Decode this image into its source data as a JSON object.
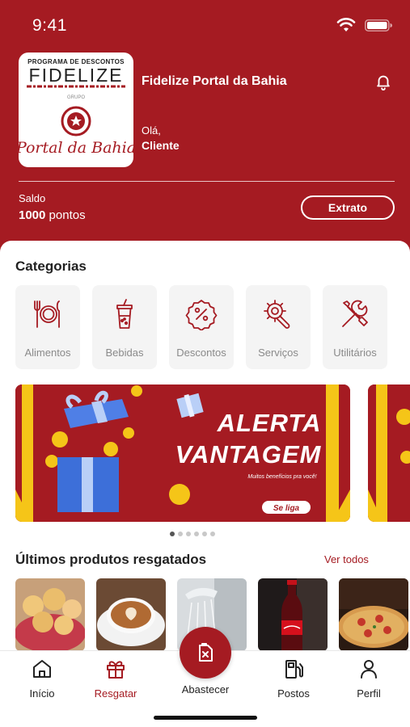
{
  "status": {
    "time": "9:41"
  },
  "header": {
    "logo": {
      "program_text": "PROGRAMA DE DESCONTOS",
      "brand_text": "FIDELIZE",
      "group_text": "GRUPO",
      "script_text": "Portal da Bahia"
    },
    "title": "Fidelize Portal da Bahia",
    "greeting": "Olá,",
    "user_name": "Cliente",
    "balance_label": "Saldo",
    "balance_value": "1000",
    "balance_unit": "pontos",
    "statement_button": "Extrato"
  },
  "categories": {
    "title": "Categorias",
    "items": [
      {
        "label": "Alimentos",
        "icon": "plate-cutlery-icon"
      },
      {
        "label": "Bebidas",
        "icon": "drink-cup-icon"
      },
      {
        "label": "Descontos",
        "icon": "percent-badge-icon"
      },
      {
        "label": "Serviços",
        "icon": "gear-wrench-icon"
      },
      {
        "label": "Utilitários",
        "icon": "tools-icon"
      }
    ]
  },
  "banner": {
    "line1": "ALERTA",
    "line2": "VANTAGEM",
    "tagline": "Muitos benefícios pra você!",
    "cta": "Se liga",
    "slides": 6,
    "active_slide": 1
  },
  "redeemed": {
    "title": "Últimos produtos resgatados",
    "see_all": "Ver todos"
  },
  "nav": {
    "items": [
      {
        "label": "Início",
        "icon": "home-icon"
      },
      {
        "label": "Resgatar",
        "icon": "gift-icon",
        "active": true
      },
      {
        "label": "Abastecer",
        "icon": "fuel-can-icon"
      },
      {
        "label": "Postos",
        "icon": "fuel-pump-icon"
      },
      {
        "label": "Perfil",
        "icon": "user-icon"
      }
    ]
  },
  "colors": {
    "brand": "#a51b22",
    "accent_yellow": "#f5c518",
    "muted": "#8a8a8a"
  }
}
